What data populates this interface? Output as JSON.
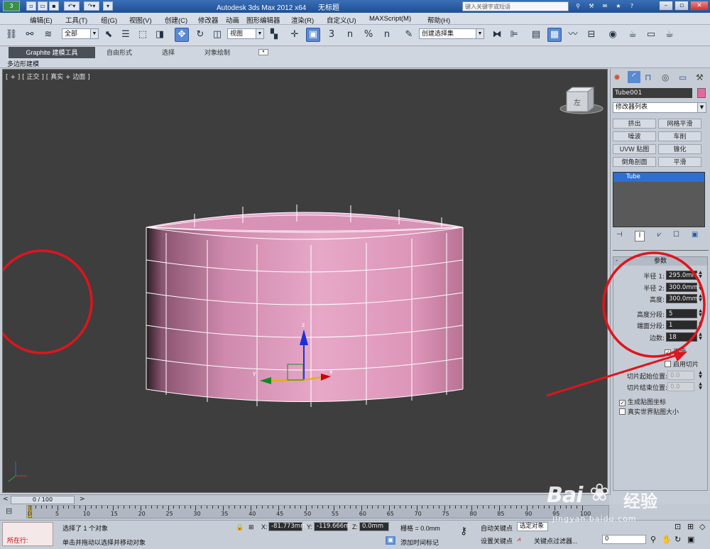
{
  "title_bar": {
    "app": "Autodesk 3ds Max  2012 x64",
    "document": "无标题",
    "search_placeholder": "键入关键字或短语"
  },
  "menu": [
    "编辑(E)",
    "工具(T)",
    "组(G)",
    "视图(V)",
    "创建(C)",
    "修改器",
    "动画",
    "图形编辑器",
    "渲染(R)",
    "自定义(U)",
    "MAXScript(M)",
    "帮助(H)"
  ],
  "toolbar": {
    "selection_filter": "全部",
    "reference_coord": "视图",
    "named_selection": "创建选择集",
    "snap_number": "3",
    "angle_snap": "n",
    "percent_snap": "%",
    "spinner_snap": "n"
  },
  "ribbon": {
    "tabs": [
      "Graphite 建模工具",
      "自由形式",
      "选择",
      "对象绘制"
    ],
    "subtab": "多边形建模"
  },
  "viewport": {
    "label": "[ + ] [ 正交 ] [ 真实 + 边面 ]",
    "viewcube_face": "左",
    "axis_z": "z",
    "axis_x": "x",
    "axis_y": "y"
  },
  "command_panel": {
    "object_name": "Tube001",
    "object_color": "#e06aa0",
    "modifier_list": "修改器列表",
    "modifier_buttons": [
      "挤出",
      "网格平滑",
      "噪波",
      "车削",
      "UVW 贴图",
      "锥化",
      "倒角剖面",
      "平滑"
    ],
    "stack_item": "Tube",
    "rollout_title": "参数",
    "params": [
      {
        "label": "半径 1:",
        "value": "295.0mm"
      },
      {
        "label": "半径 2:",
        "value": "300.0mm"
      },
      {
        "label": "高度:",
        "value": "300.0mm"
      },
      {
        "label": "高度分段:",
        "value": "5"
      },
      {
        "label": "端面分段:",
        "value": "1"
      },
      {
        "label": "边数:",
        "value": "18"
      }
    ],
    "smooth_label": "平滑",
    "smooth_checked": "✓",
    "slice_label": "启用切片",
    "slice_from_label": "切片起始位置:",
    "slice_from_value": "0.0",
    "slice_to_label": "切片结束位置:",
    "slice_to_value": "0.0",
    "gen_map_label": "生成贴图坐标",
    "gen_map_checked": "✓",
    "real_world_label": "真实世界贴图大小"
  },
  "timeline": {
    "slider_label": "0 / 100",
    "ticks": [
      "0",
      "5",
      "10",
      "15",
      "20",
      "25",
      "30",
      "35",
      "40",
      "45",
      "50",
      "55",
      "60",
      "65",
      "70",
      "75",
      "80",
      "85",
      "90",
      "95",
      "100"
    ]
  },
  "status": {
    "script_label": "所在行:",
    "selected": "选择了 1 个对象",
    "prompt": "单击并拖动以选择并移动对象",
    "x_label": "X:",
    "x_value": "-81.773mm",
    "y_label": "Y:",
    "y_value": "-119.666m",
    "z_label": "Z:",
    "z_value": "0.0mm",
    "grid": "栅格 = 0.0mm",
    "add_time_tag": "添加时间标记",
    "auto_key": "自动关键点",
    "selected_objects": "选定对象",
    "set_key": "设置关键点",
    "key_filters": "关键点过滤器...",
    "frame": "0"
  },
  "watermark": {
    "text1": "Bai",
    "text2": "经验",
    "url": "jingyan.baidu.com"
  },
  "annotation_color": "#e0141c",
  "tube_color": "#e7a3c6"
}
